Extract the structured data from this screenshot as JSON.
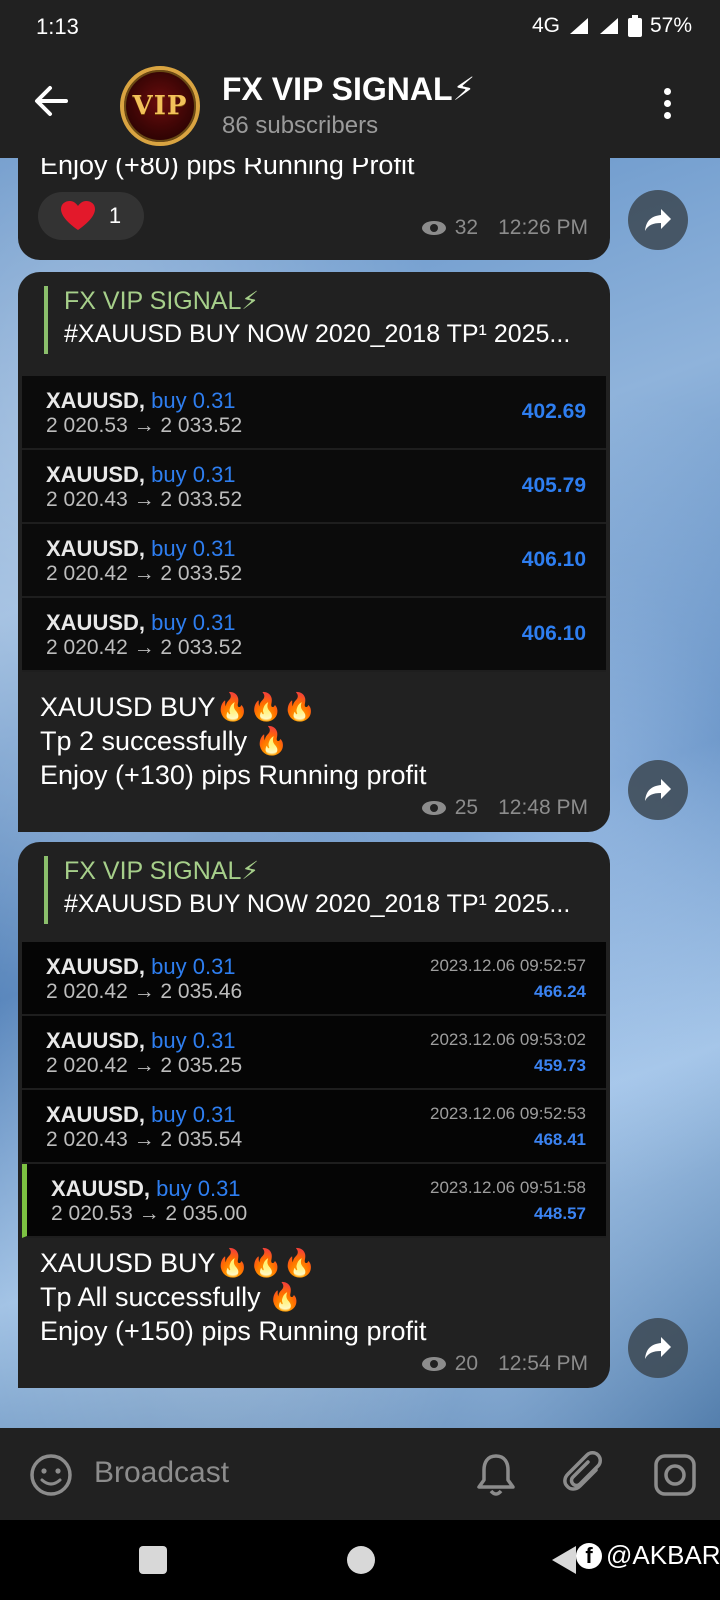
{
  "status": {
    "time": "1:13",
    "network": "4G",
    "battery": "57%"
  },
  "header": {
    "avatar_text": "VIP",
    "title": "FX VIP SIGNAL⚡",
    "subtitle": "86 subscribers"
  },
  "messages": [
    {
      "text_lines": [
        "Enjoy (+80) pips Running Profit"
      ],
      "reaction": {
        "emoji": "❤️",
        "count": "1"
      },
      "views": "32",
      "time": "12:26 PM"
    },
    {
      "reply": {
        "name": "FX VIP SIGNAL⚡",
        "text": "#XAUUSD BUY NOW 2020_2018  TP¹ 2025..."
      },
      "trades": [
        {
          "symbol": "XAUUSD,",
          "side": "buy 0.31",
          "prices": "2 020.53 → 2 033.52",
          "profit": "402.69"
        },
        {
          "symbol": "XAUUSD,",
          "side": "buy 0.31",
          "prices": "2 020.43 → 2 033.52",
          "profit": "405.79"
        },
        {
          "symbol": "XAUUSD,",
          "side": "buy 0.31",
          "prices": "2 020.42 → 2 033.52",
          "profit": "406.10"
        },
        {
          "symbol": "XAUUSD,",
          "side": "buy 0.31",
          "prices": "2 020.42 → 2 033.52",
          "profit": "406.10"
        }
      ],
      "text_lines": [
        "XAUUSD BUY🔥🔥🔥",
        "Tp 2 successfully 🔥",
        "Enjoy (+130) pips Running profit"
      ],
      "views": "25",
      "time": "12:48 PM"
    },
    {
      "reply": {
        "name": "FX VIP SIGNAL⚡",
        "text": "#XAUUSD BUY NOW 2020_2018  TP¹ 2025..."
      },
      "trades": [
        {
          "symbol": "XAUUSD,",
          "side": "buy 0.31",
          "prices": "2 020.42 → 2 035.46",
          "datetime": "2023.12.06 09:52:57",
          "profit": "466.24"
        },
        {
          "symbol": "XAUUSD,",
          "side": "buy 0.31",
          "prices": "2 020.42 → 2 035.25",
          "datetime": "2023.12.06 09:53:02",
          "profit": "459.73"
        },
        {
          "symbol": "XAUUSD,",
          "side": "buy 0.31",
          "prices": "2 020.43 → 2 035.54",
          "datetime": "2023.12.06 09:52:53",
          "profit": "468.41"
        },
        {
          "symbol": "XAUUSD,",
          "side": "buy 0.31",
          "prices": "2 020.53 → 2 035.00",
          "datetime": "2023.12.06 09:51:58",
          "profit": "448.57"
        }
      ],
      "text_lines": [
        "XAUUSD BUY🔥🔥🔥",
        "Tp All successfully 🔥",
        "Enjoy (+150) pips Running profit"
      ],
      "views": "20",
      "time": "12:54 PM"
    }
  ],
  "input": {
    "placeholder": "Broadcast"
  },
  "watermark": {
    "text": "@AKBAR",
    "fb_letter": "f"
  },
  "colors": {
    "accent_green": "#a6cf8a",
    "profit_blue": "#2e7ef0",
    "bubble": "#212121"
  },
  "icons": [
    "back-arrow-icon",
    "more-vert-icon",
    "forward-icon",
    "eye-icon",
    "emoji-icon",
    "bell-icon",
    "attach-icon",
    "camera-icon"
  ]
}
